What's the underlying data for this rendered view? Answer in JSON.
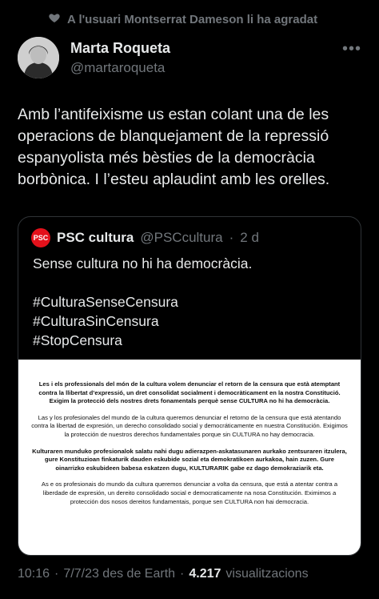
{
  "social_context": {
    "text": "A l'usuari Montserrat Dameson li ha agradat"
  },
  "author": {
    "name": "Marta Roqueta",
    "handle": "@martaroqueta"
  },
  "more_icon": "dots-icon",
  "tweet": {
    "text": "Amb l’antifeixisme us estan colant una de les operacions de blanquejament de la repressió espanyolista més bèsties de la democràcia borbònica. I l’esteu aplaudint amb les orelles."
  },
  "quote": {
    "logo_text": "PSC",
    "name": "PSC cultura",
    "handle": "@PSCcultura",
    "separator": "·",
    "time": "2 d",
    "text": "Sense cultura no hi ha democràcia.",
    "hashtags": [
      "#CulturaSenseCensura",
      "#CulturaSinCensura",
      "#StopCensura"
    ],
    "image": {
      "paragraphs": [
        {
          "bold": "Les i els professionals del món de la cultura volem denunciar el retorn de la censura que està atemptant contra la llibertat d’expressió, un dret consolidat socialment i democràticament en la nostra Constitució. Exigim la protecció dels nostres drets fonamentals perquè sense CULTURA no hi ha democràcia."
        },
        {
          "normal": "Las y los profesionales del mundo de la cultura queremos denunciar el retorno de la censura que está atentando contra la libertad de expresión, un derecho consolidado social y democráticamente en nuestra Constitución. Exigimos la protección de nuestros derechos fundamentales porque sin CULTURA no hay democracia."
        },
        {
          "bold": "Kulturaren munduko profesionalok salatu nahi dugu adierazpen-askatasunaren aurkako zentsuraren itzulera, gure Konstituzioan finkaturik dauden eskubide sozial eta demokratikoen aurkakoa, hain zuzen. Gure oinarrizko eskubideen babesa eskatzen dugu, KULTURARIK gabe ez dago demokraziarik eta."
        },
        {
          "normal": "As e os profesionais do mundo da cultura queremos denunciar a volta da censura, que está a atentar contra a liberdade de expresión, un dereito consolidado social e democraticamente na nosa Constitución. Eximimos a protección dos nosos dereitos fundamentais, porque sen CULTURA non hai democracia."
        }
      ]
    }
  },
  "footer": {
    "time": "10:16",
    "separator": "·",
    "date": "7/7/23 des de Earth",
    "separator2": "·",
    "views": "4.217",
    "views_label": "visualitzacions"
  }
}
